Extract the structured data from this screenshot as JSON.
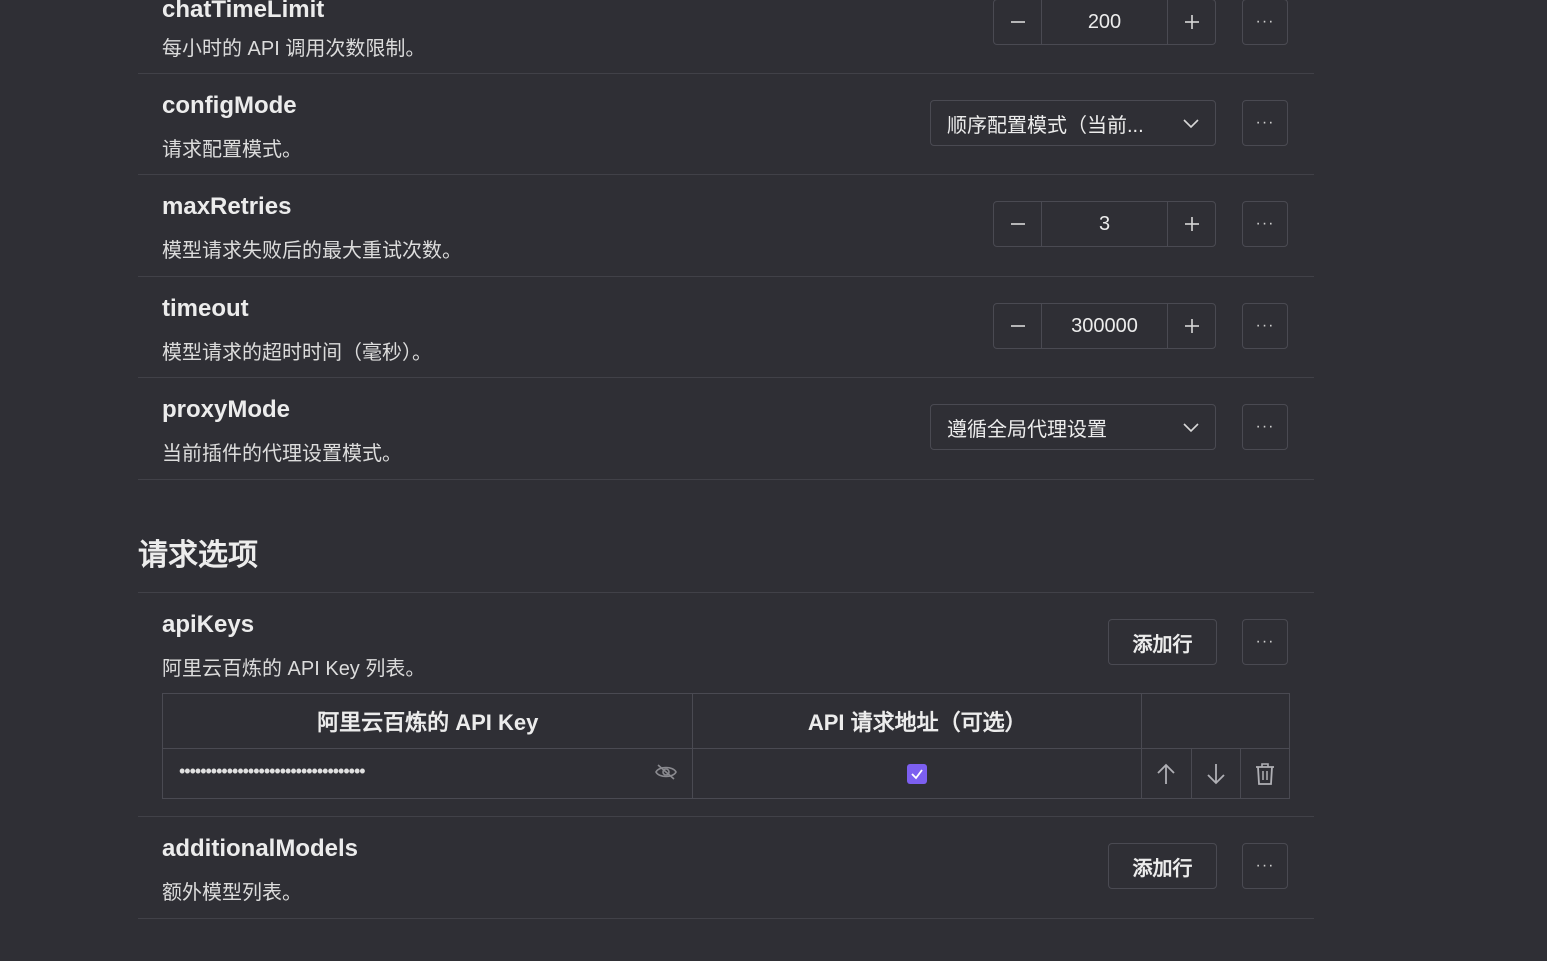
{
  "settings": [
    {
      "title": "chatTimeLimit",
      "desc": "每小时的 API 调用次数限制。",
      "value": "200"
    },
    {
      "title": "configMode",
      "desc": "请求配置模式。",
      "value": "顺序配置模式（当前..."
    },
    {
      "title": "maxRetries",
      "desc": "模型请求失败后的最大重试次数。",
      "value": "3"
    },
    {
      "title": "timeout",
      "desc": "模型请求的超时时间（毫秒）。",
      "value": "300000"
    },
    {
      "title": "proxyMode",
      "desc": "当前插件的代理设置模式。",
      "value": "遵循全局代理设置"
    }
  ],
  "section": {
    "title": "请求选项"
  },
  "apiKeys": {
    "title": "apiKeys",
    "desc": "阿里云百炼的 API Key 列表。",
    "add_label": "添加行",
    "columns": [
      "阿里云百炼的 API Key",
      "API 请求地址（可选）",
      ""
    ],
    "rows": [
      {
        "key_masked": "•••••••••••••••••••••••••••••••••••",
        "checked": true
      }
    ]
  },
  "additionalModels": {
    "title": "additionalModels",
    "desc": "额外模型列表。",
    "add_label": "添加行"
  },
  "labels": {
    "more": "···",
    "minus": "−",
    "plus": "+"
  },
  "colors": {
    "background": "#2f2f35",
    "border": "#4a4a52",
    "checkbox": "#7c5ff0"
  },
  "icons": [
    "minus-icon",
    "plus-icon",
    "more-icon",
    "chevron-down-icon",
    "eye-off-icon",
    "check-icon",
    "arrow-up-icon",
    "arrow-down-icon",
    "trash-icon"
  ]
}
